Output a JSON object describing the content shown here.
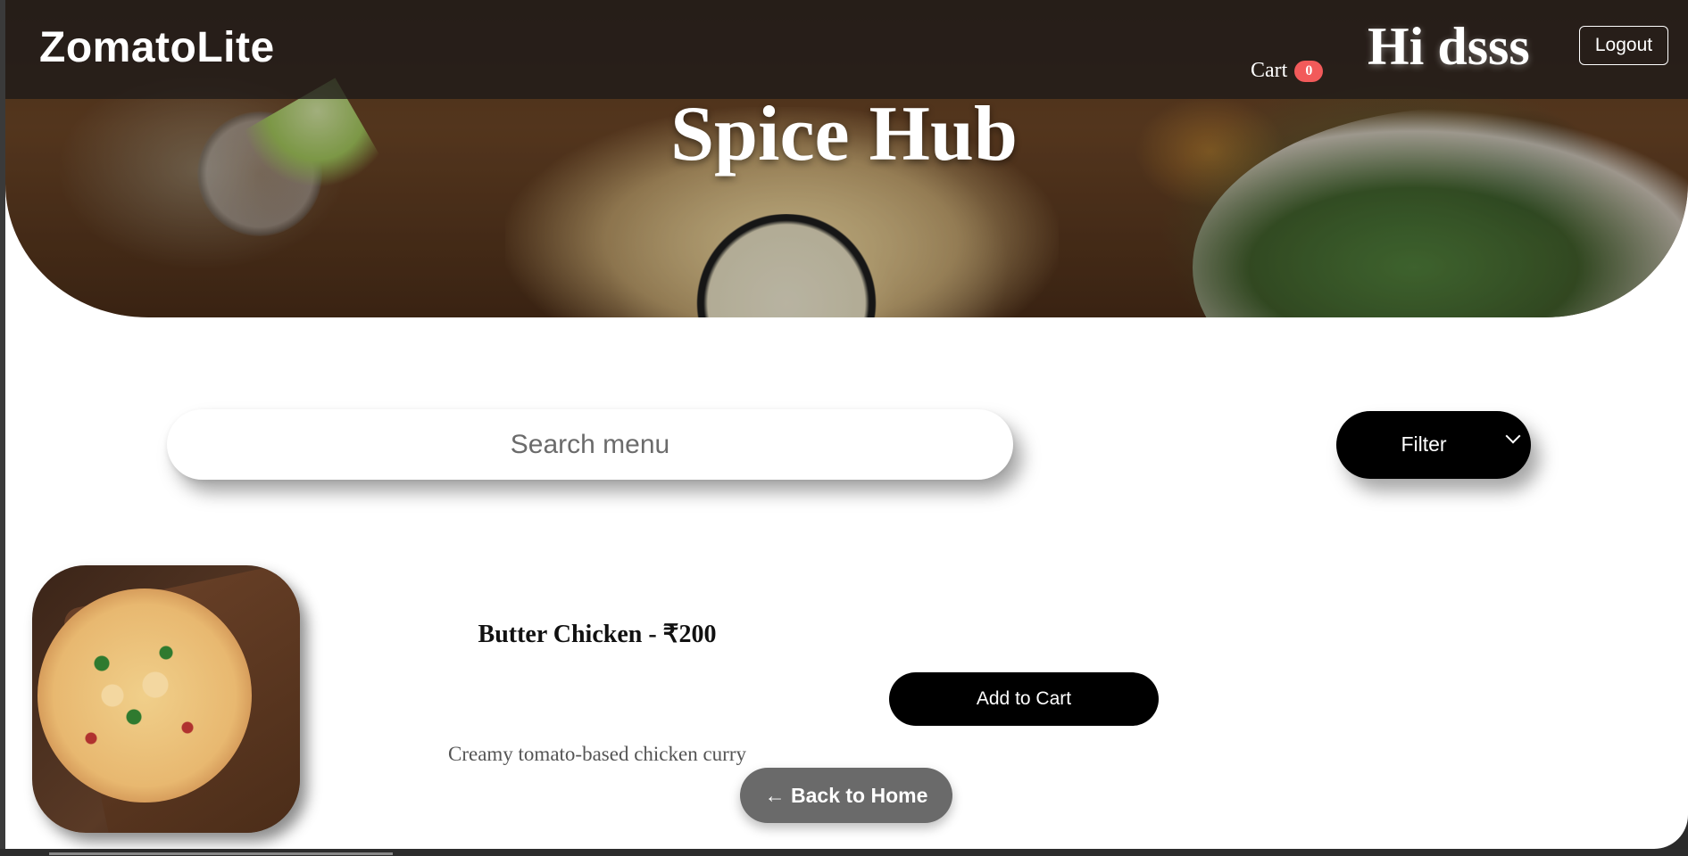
{
  "navbar": {
    "brand": "ZomatoLite",
    "cart_label": "Cart",
    "cart_count": "0",
    "greeting": "Hi dsss",
    "logout_label": "Logout"
  },
  "hero": {
    "restaurant_name": "Spice Hub"
  },
  "controls": {
    "search_placeholder": "Search menu",
    "filter_label": "Filter"
  },
  "menu": {
    "items": [
      {
        "name": "Butter Chicken - ₹200",
        "description": "Creamy tomato-based chicken curry",
        "add_to_cart_label": "Add to Cart",
        "image": "pizza-photo"
      }
    ]
  },
  "footer": {
    "back_label": "← Back to Home"
  },
  "colors": {
    "cart_badge": "#f25a5a",
    "primary_button": "#000000",
    "back_button": "#6a6a6a"
  }
}
